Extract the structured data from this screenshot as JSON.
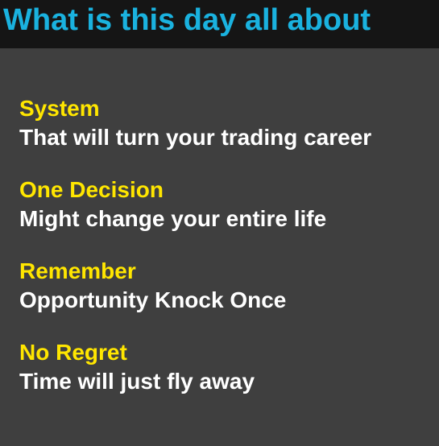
{
  "title": "What is this day all about",
  "colors": {
    "title": "#1ab2df",
    "heading": "#ffe600",
    "text": "#ffffff",
    "title_bar_bg": "#151515",
    "background": "#3f3f3f"
  },
  "sections": [
    {
      "heading": "System",
      "text": "That will turn your trading career"
    },
    {
      "heading": "One Decision",
      "text": "Might change your entire life"
    },
    {
      "heading": "Remember",
      "text": "Opportunity Knock Once"
    },
    {
      "heading": "No Regret",
      "text": "Time will just fly away"
    }
  ]
}
